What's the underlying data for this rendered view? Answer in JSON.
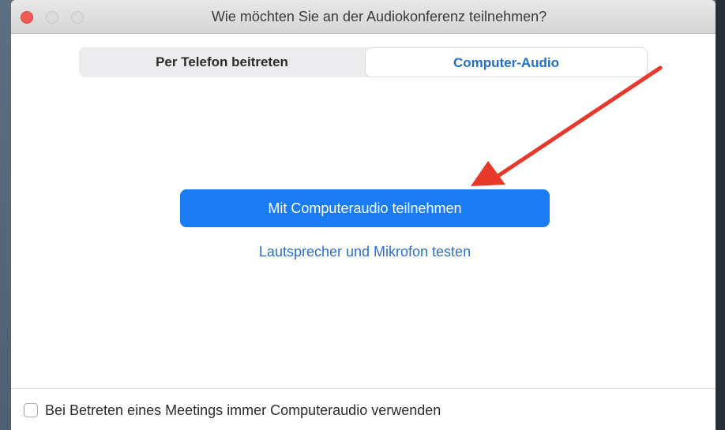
{
  "window": {
    "title": "Wie möchten Sie an der Audiokonferenz teilnehmen?"
  },
  "tabs": [
    {
      "label": "Per Telefon beitreten",
      "selected": false
    },
    {
      "label": "Computer-Audio",
      "selected": true
    }
  ],
  "main": {
    "join_button_label": "Mit Computeraudio teilnehmen",
    "test_link_label": "Lautsprecher und Mikrofon testen"
  },
  "footer": {
    "checkbox_label": "Bei Betreten eines Meetings immer Computeraudio verwenden",
    "checkbox_checked": false
  },
  "colors": {
    "accent": "#1a7cf5",
    "link": "#2a6fd0",
    "annotation_arrow": "#e8382a"
  }
}
